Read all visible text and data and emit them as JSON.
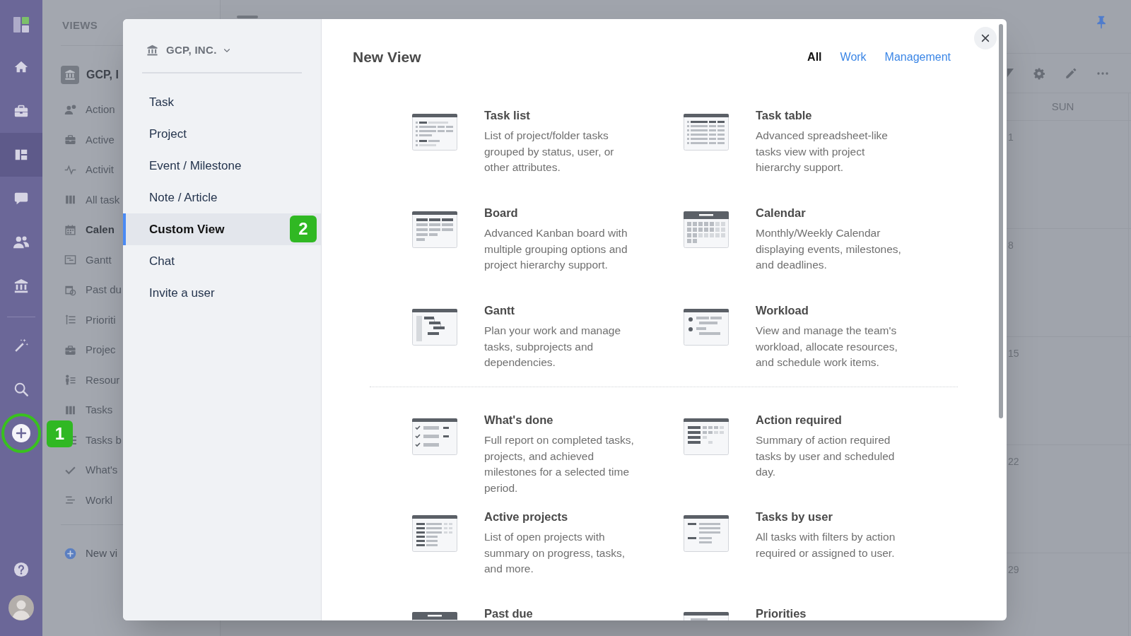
{
  "nav_rail": {
    "items": [
      {
        "selected": false
      },
      {
        "selected": false
      },
      {
        "selected": true
      },
      {
        "selected": false
      },
      {
        "selected": false
      },
      {
        "selected": false
      }
    ],
    "add_button": {
      "highlighted": true,
      "badge": "1"
    }
  },
  "views_panel": {
    "title": "VIEWS",
    "workspace": "GCP, I",
    "items": [
      {
        "label": "Action",
        "selected": false
      },
      {
        "label": "Active",
        "selected": false
      },
      {
        "label": "Activit",
        "selected": false
      },
      {
        "label": "All task",
        "selected": false
      },
      {
        "label": "Calen",
        "selected": true
      },
      {
        "label": "Gantt",
        "selected": false
      },
      {
        "label": "Past du",
        "selected": false
      },
      {
        "label": "Prioriti",
        "selected": false
      },
      {
        "label": "Projec",
        "selected": false
      },
      {
        "label": "Resour",
        "selected": false
      },
      {
        "label": "Tasks",
        "selected": false
      },
      {
        "label": "Tasks b",
        "selected": false
      },
      {
        "label": "What's",
        "selected": false
      },
      {
        "label": "Workl",
        "selected": false
      }
    ],
    "new_view": "New vi"
  },
  "main": {
    "day_header": "SUN",
    "weeks": [
      {
        "date": "1"
      },
      {
        "date": "8"
      },
      {
        "date": "15"
      },
      {
        "date": "22"
      },
      {
        "date": "29"
      }
    ]
  },
  "modal": {
    "workspace": "GCP, INC.",
    "menu": [
      {
        "label": "Task",
        "selected": false
      },
      {
        "label": "Project",
        "selected": false
      },
      {
        "label": "Event / Milestone",
        "selected": false
      },
      {
        "label": "Note / Article",
        "selected": false
      },
      {
        "label": "Custom View",
        "selected": true,
        "badge": "2"
      },
      {
        "label": "Chat",
        "selected": false
      },
      {
        "label": "Invite a user",
        "selected": false
      }
    ],
    "title": "New View",
    "filters": [
      {
        "label": "All",
        "selected": true
      },
      {
        "label": "Work",
        "selected": false
      },
      {
        "label": "Management",
        "selected": false
      }
    ],
    "sections": [
      {
        "cards": [
          {
            "kind": "task_list",
            "title": "Task list",
            "description": "List of project/folder tasks grouped by status, user, or other attributes."
          },
          {
            "kind": "task_table",
            "title": "Task table",
            "description": "Advanced spreadsheet-like tasks view with project hierarchy support."
          },
          {
            "kind": "board",
            "title": "Board",
            "description": "Advanced Kanban board with multiple grouping options and project hierarchy support."
          },
          {
            "kind": "calendar",
            "title": "Calendar",
            "description": "Monthly/Weekly Calendar displaying events, milestones, and deadlines."
          },
          {
            "kind": "gantt",
            "title": "Gantt",
            "description": "Plan your work and manage tasks, subprojects and dependencies."
          },
          {
            "kind": "workload",
            "title": "Workload",
            "description": "View and manage the team's workload, allocate resources, and schedule work items."
          }
        ]
      },
      {
        "cards": [
          {
            "kind": "whats_done",
            "title": "What's done",
            "description": "Full report on completed tasks, projects, and achieved milestones for a selected time period."
          },
          {
            "kind": "action_required",
            "title": "Action required",
            "description": "Summary of action required tasks by user and scheduled day."
          },
          {
            "kind": "active_projects",
            "title": "Active projects",
            "description": "List of open projects with summary on progress, tasks, and more."
          },
          {
            "kind": "tasks_by_user",
            "title": "Tasks by user",
            "description": "All tasks with filters by action required or assigned to user."
          },
          {
            "kind": "past_due",
            "title": "Past due"
          },
          {
            "kind": "priorities",
            "title": "Priorities"
          }
        ]
      }
    ]
  }
}
